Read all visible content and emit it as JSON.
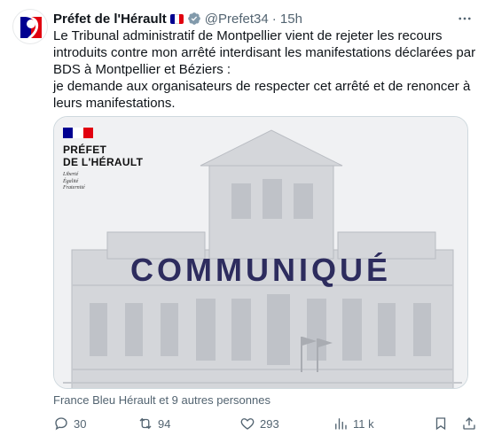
{
  "tweet": {
    "display_name": "Préfet de l'Hérault",
    "handle": "@Prefet34",
    "time": "· 15h",
    "text_line1": "Le Tribunal administratif de Montpellier vient de rejeter les recours introduits contre mon arrêté interdisant les manifestations déclarées par BDS à Montpellier et Béziers :",
    "text_line2": "je demande aux organisateurs de respecter cet arrêté et de renoncer à leurs manifestations."
  },
  "media": {
    "pref_line1": "PRÉFET",
    "pref_line2": "DE L'HÉRAULT",
    "motto": [
      "Liberté",
      "Égalité",
      "Fraternité"
    ],
    "headline": "COMMUNIQUÉ"
  },
  "tagged": "France Bleu Hérault et 9 autres personnes",
  "actions": {
    "replies": "30",
    "retweets": "94",
    "likes": "293",
    "views": "11 k"
  },
  "colors": {
    "flag_blue": "#000091",
    "flag_red": "#e1000f",
    "verified_gray": "#829aab",
    "headline": "#2d2c5e"
  }
}
